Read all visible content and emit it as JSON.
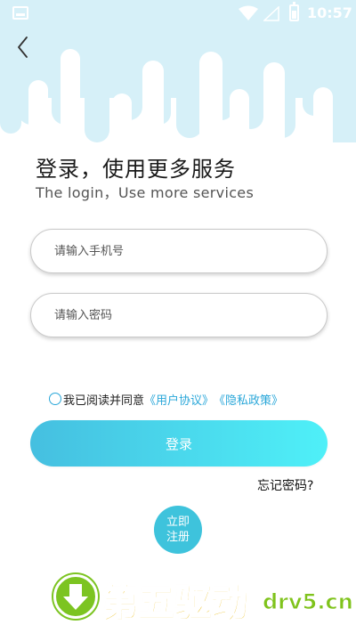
{
  "status_bar": {
    "time": "10:57"
  },
  "header": {
    "back_icon": "chevron-left-icon",
    "wave_color": "#d6f0f8"
  },
  "login": {
    "title": "登录，使用更多服务",
    "subtitle": "The login，Use more services",
    "phone_placeholder": "请输入手机号",
    "password_placeholder": "请输入密码",
    "agreement_prefix": "我已阅读并同意",
    "user_agreement_link": "《用户协议》",
    "privacy_link": "《隐私政策》",
    "login_button": "登录",
    "forgot_password": "忘记密码?",
    "register_line1": "立即",
    "register_line2": "注册",
    "accent_color": "#2aa7d9"
  },
  "watermark": {
    "text_cn": "第五驱动",
    "text_en": "drv5.cn"
  }
}
